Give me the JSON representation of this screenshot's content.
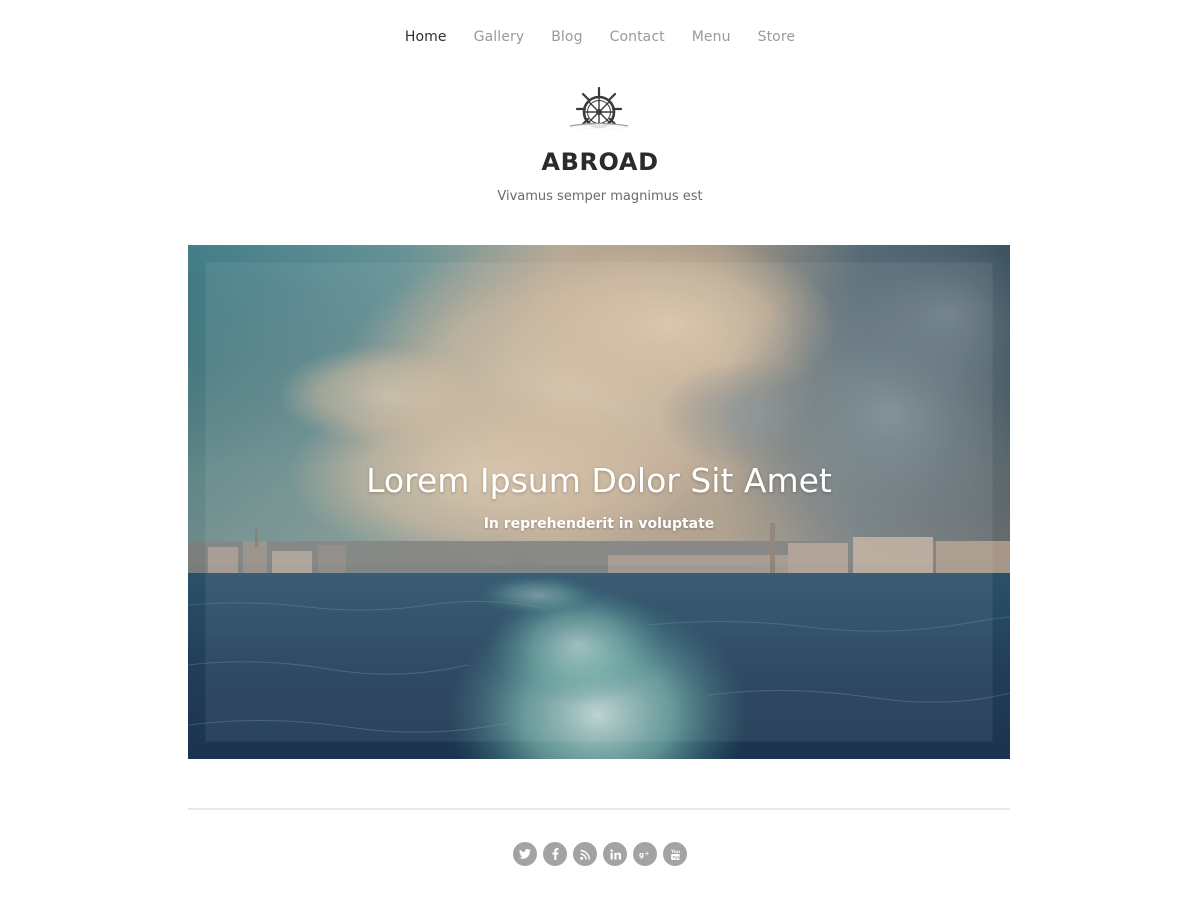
{
  "nav": {
    "items": [
      {
        "label": "Home",
        "active": true
      },
      {
        "label": "Gallery",
        "active": false
      },
      {
        "label": "Blog",
        "active": false
      },
      {
        "label": "Contact",
        "active": false
      },
      {
        "label": "Menu",
        "active": false
      },
      {
        "label": "Store",
        "active": false
      }
    ]
  },
  "site": {
    "logo_icon": "ship-wheel-icon",
    "title": "ABROAD",
    "tagline": "Vivamus semper magnimus est"
  },
  "hero": {
    "title": "Lorem Ipsum Dolor Sit Amet",
    "subtitle": "In reprehenderit in voluptate",
    "image": "sea-city-skyline-photo"
  },
  "footer": {
    "social": [
      {
        "name": "twitter-icon",
        "glyph": "t"
      },
      {
        "name": "facebook-icon",
        "glyph": "f"
      },
      {
        "name": "rss-icon",
        "glyph": "rss"
      },
      {
        "name": "linkedin-icon",
        "glyph": "in"
      },
      {
        "name": "google-plus-icon",
        "glyph": "g+"
      },
      {
        "name": "youtube-icon",
        "glyph": "yt"
      }
    ]
  },
  "colors": {
    "nav_active": "#2f2f2f",
    "nav_inactive": "#9a9a9a",
    "title": "#2b2b2b",
    "social_bg": "#a3a3a3",
    "divider": "#e8e8e8"
  }
}
